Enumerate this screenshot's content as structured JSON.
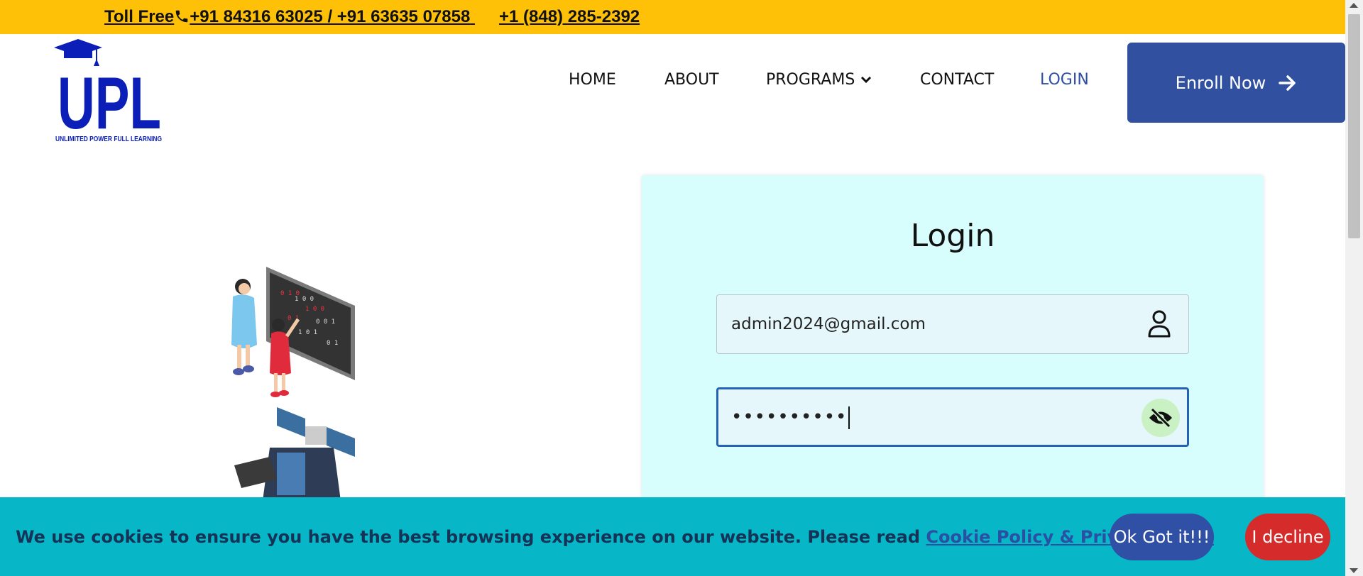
{
  "topbar": {
    "toll_free_label": "Toll Free",
    "india_numbers": "+91 84316 63025 / +91 63635 07858",
    "us_number": "+1 (848) 285-2392"
  },
  "logo": {
    "letters": "UPL",
    "tagline": "UNLIMITED POWER FULL LEARNING"
  },
  "nav": {
    "items": [
      {
        "label": "HOME"
      },
      {
        "label": "ABOUT"
      },
      {
        "label": "PROGRAMS"
      },
      {
        "label": "CONTACT"
      },
      {
        "label": "LOGIN"
      }
    ],
    "enroll_label": "Enroll Now"
  },
  "login": {
    "title": "Login",
    "email_value": "admin2024@gmail.com",
    "password_masked": "••••••••••"
  },
  "cookie": {
    "message": "We use cookies to ensure you have the best browsing experience on our website. Please read",
    "link_label": "Cookie Policy & Privacy Policy",
    "ok_label": "Ok Got it!!!",
    "decline_label": "I decline"
  },
  "colors": {
    "topbar_bg": "#ffc107",
    "brand_blue": "#3150a0",
    "logo_blue": "#0b1fb8",
    "card_bg": "#d7fdfd",
    "cookie_bg": "#07b7c8",
    "decline_red": "#d52b2b"
  }
}
